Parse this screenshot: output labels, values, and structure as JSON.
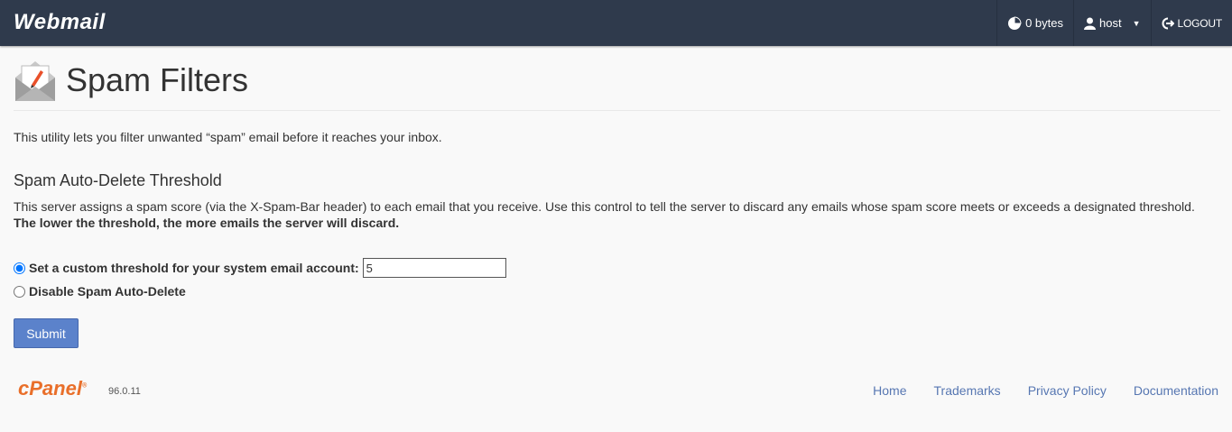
{
  "header": {
    "logo": "Webmail",
    "disk_usage": "0 bytes",
    "user": "host",
    "logout": "LOGOUT"
  },
  "page": {
    "title": "Spam Filters",
    "intro": "This utility lets you filter unwanted “spam” email before it reaches your inbox."
  },
  "threshold_section": {
    "heading": "Spam Auto-Delete Threshold",
    "description": "This server assigns a spam score (via the X-Spam-Bar header) to each email that you receive. Use this control to tell the server to discard any emails whose spam score meets or exceeds a designated threshold.",
    "description_bold": "The lower the threshold, the more emails the server will discard.",
    "option_custom_label": "Set a custom threshold for your system email account:",
    "option_custom_selected": true,
    "threshold_value": "5",
    "option_disable_label": "Disable Spam Auto-Delete",
    "submit_label": "Submit"
  },
  "footer": {
    "logo": "cPanel",
    "registered_mark": "®",
    "version": "96.0.11",
    "links": [
      "Home",
      "Trademarks",
      "Privacy Policy",
      "Documentation"
    ]
  },
  "colors": {
    "header_bg": "#2f3a4c",
    "accent_button": "#5b82cb",
    "link": "#5777b2",
    "cpanel_orange": "#e96f2a"
  },
  "icons": {
    "disk": "pie-chart-icon",
    "user": "user-icon",
    "logout": "logout-icon",
    "page": "envelope-pen-icon"
  }
}
